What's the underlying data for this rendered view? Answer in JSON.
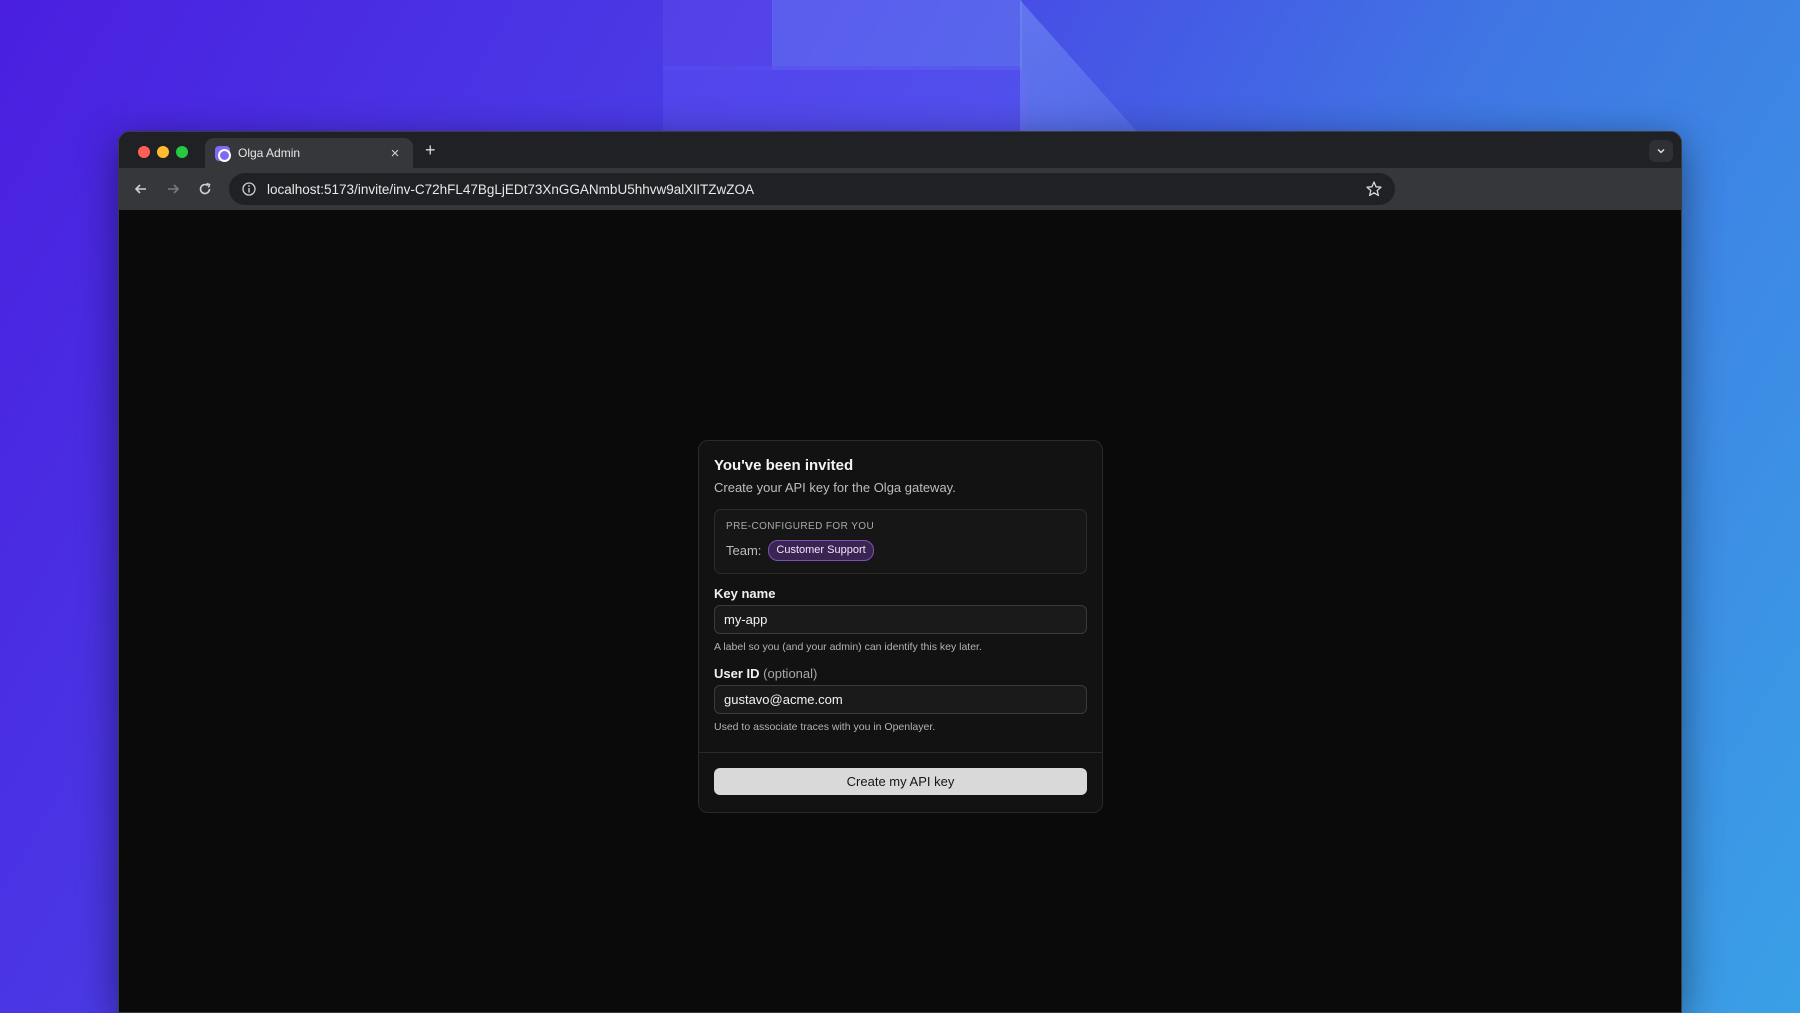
{
  "browser": {
    "tab": {
      "title": "Olga Admin",
      "favicon": "olga-logo-icon",
      "close_glyph": "×"
    },
    "new_tab_glyph": "+",
    "address": {
      "url": "localhost:5173/invite/inv-C72hFL47BgLjEDt73XnGGANmbU5hhvw9alXlITZwZOA"
    }
  },
  "invite": {
    "title": "You've been invited",
    "subtitle": "Create your API key for the Olga gateway.",
    "preconfigured": {
      "heading": "PRE-CONFIGURED FOR YOU",
      "team_label": "Team:",
      "team_value": "Customer Support"
    },
    "key_name": {
      "label": "Key name",
      "value": "my-app",
      "hint": "A label so you (and your admin) can identify this key later."
    },
    "user_id": {
      "label": "User ID",
      "optional": "(optional)",
      "value": "gustavo@acme.com",
      "hint": "Used to associate traces with you in Openlayer."
    },
    "submit_label": "Create my API key"
  },
  "colors": {
    "accent_badge": "#7b53b8",
    "button_bg": "#d9d9d9",
    "page_bg": "#0a0a0a"
  }
}
